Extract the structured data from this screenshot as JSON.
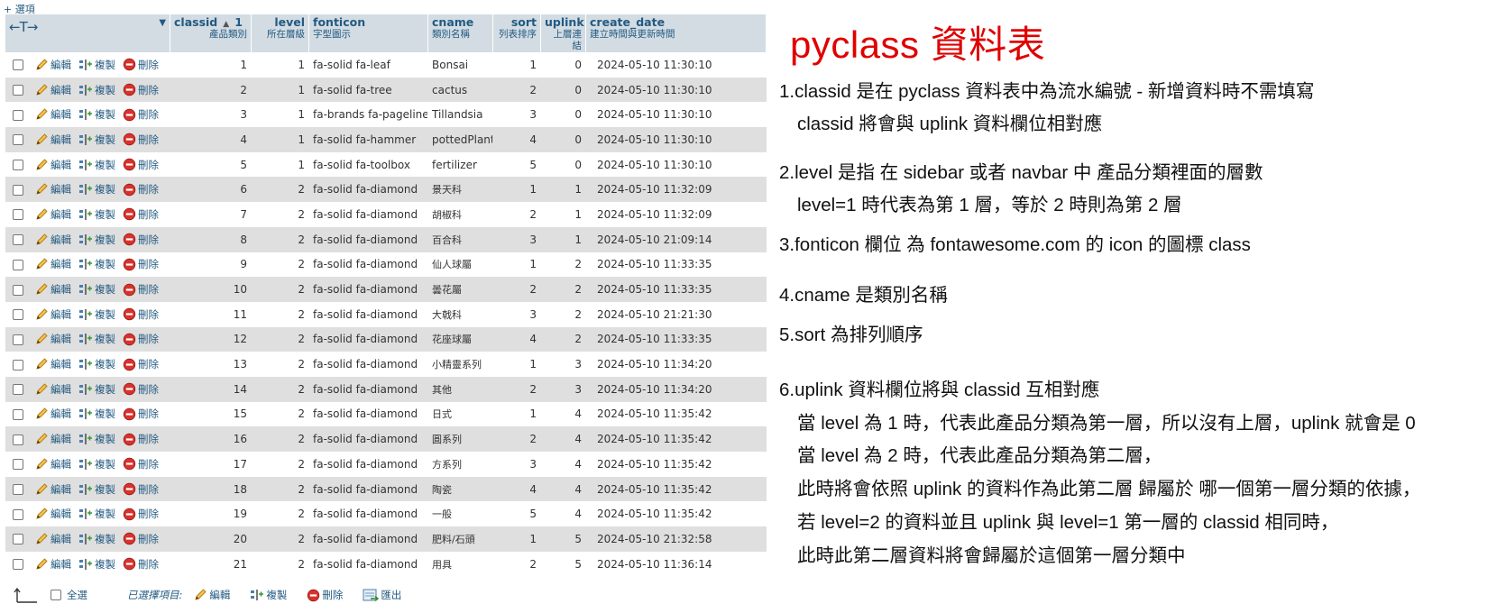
{
  "options_link": "+ 選項",
  "columns": [
    {
      "name": "classid",
      "sub": "產品類別",
      "sort_order": "1"
    },
    {
      "name": "level",
      "sub": "所在層級"
    },
    {
      "name": "fonticon",
      "sub": "字型圖示"
    },
    {
      "name": "cname",
      "sub": "類別名稱"
    },
    {
      "name": "sort",
      "sub": "列表排序"
    },
    {
      "name": "uplink",
      "sub": "上層連結"
    },
    {
      "name": "create_date",
      "sub": "建立時間與更新時間"
    }
  ],
  "row_actions": {
    "edit": "編輯",
    "copy": "複製",
    "delete": "刪除"
  },
  "rows": [
    {
      "classid": "1",
      "level": "1",
      "fonticon": "fa-solid fa-leaf",
      "cname": "Bonsai",
      "sort": "1",
      "uplink": "0",
      "create_date": "2024-05-10 11:30:10"
    },
    {
      "classid": "2",
      "level": "1",
      "fonticon": "fa-solid fa-tree",
      "cname": "cactus",
      "sort": "2",
      "uplink": "0",
      "create_date": "2024-05-10 11:30:10"
    },
    {
      "classid": "3",
      "level": "1",
      "fonticon": "fa-brands fa-pagelines",
      "cname": "Tillandsia",
      "sort": "3",
      "uplink": "0",
      "create_date": "2024-05-10 11:30:10"
    },
    {
      "classid": "4",
      "level": "1",
      "fonticon": "fa-solid fa-hammer",
      "cname": "pottedPlant",
      "sort": "4",
      "uplink": "0",
      "create_date": "2024-05-10 11:30:10"
    },
    {
      "classid": "5",
      "level": "1",
      "fonticon": "fa-solid fa-toolbox",
      "cname": "fertilizer",
      "sort": "5",
      "uplink": "0",
      "create_date": "2024-05-10 11:30:10"
    },
    {
      "classid": "6",
      "level": "2",
      "fonticon": "fa-solid fa-diamond",
      "cname": "景天科",
      "sort": "1",
      "uplink": "1",
      "create_date": "2024-05-10 11:32:09"
    },
    {
      "classid": "7",
      "level": "2",
      "fonticon": "fa-solid fa-diamond",
      "cname": "胡椒科",
      "sort": "2",
      "uplink": "1",
      "create_date": "2024-05-10 11:32:09"
    },
    {
      "classid": "8",
      "level": "2",
      "fonticon": "fa-solid fa-diamond",
      "cname": "百合科",
      "sort": "3",
      "uplink": "1",
      "create_date": "2024-05-10 21:09:14"
    },
    {
      "classid": "9",
      "level": "2",
      "fonticon": "fa-solid fa-diamond",
      "cname": "仙人球屬",
      "sort": "1",
      "uplink": "2",
      "create_date": "2024-05-10 11:33:35"
    },
    {
      "classid": "10",
      "level": "2",
      "fonticon": "fa-solid fa-diamond",
      "cname": "曇花屬",
      "sort": "2",
      "uplink": "2",
      "create_date": "2024-05-10 11:33:35"
    },
    {
      "classid": "11",
      "level": "2",
      "fonticon": "fa-solid fa-diamond",
      "cname": "大戟科",
      "sort": "3",
      "uplink": "2",
      "create_date": "2024-05-10 21:21:30"
    },
    {
      "classid": "12",
      "level": "2",
      "fonticon": "fa-solid fa-diamond",
      "cname": "花座球屬",
      "sort": "4",
      "uplink": "2",
      "create_date": "2024-05-10 11:33:35"
    },
    {
      "classid": "13",
      "level": "2",
      "fonticon": "fa-solid fa-diamond",
      "cname": "小精靈系列",
      "sort": "1",
      "uplink": "3",
      "create_date": "2024-05-10 11:34:20"
    },
    {
      "classid": "14",
      "level": "2",
      "fonticon": "fa-solid fa-diamond",
      "cname": "其他",
      "sort": "2",
      "uplink": "3",
      "create_date": "2024-05-10 11:34:20"
    },
    {
      "classid": "15",
      "level": "2",
      "fonticon": "fa-solid fa-diamond",
      "cname": "日式",
      "sort": "1",
      "uplink": "4",
      "create_date": "2024-05-10 11:35:42"
    },
    {
      "classid": "16",
      "level": "2",
      "fonticon": "fa-solid fa-diamond",
      "cname": "圓系列",
      "sort": "2",
      "uplink": "4",
      "create_date": "2024-05-10 11:35:42"
    },
    {
      "classid": "17",
      "level": "2",
      "fonticon": "fa-solid fa-diamond",
      "cname": "方系列",
      "sort": "3",
      "uplink": "4",
      "create_date": "2024-05-10 11:35:42"
    },
    {
      "classid": "18",
      "level": "2",
      "fonticon": "fa-solid fa-diamond",
      "cname": "陶瓷",
      "sort": "4",
      "uplink": "4",
      "create_date": "2024-05-10 11:35:42"
    },
    {
      "classid": "19",
      "level": "2",
      "fonticon": "fa-solid fa-diamond",
      "cname": "一般",
      "sort": "5",
      "uplink": "4",
      "create_date": "2024-05-10 11:35:42"
    },
    {
      "classid": "20",
      "level": "2",
      "fonticon": "fa-solid fa-diamond",
      "cname": "肥料/石頭",
      "sort": "1",
      "uplink": "5",
      "create_date": "2024-05-10 21:32:58"
    },
    {
      "classid": "21",
      "level": "2",
      "fonticon": "fa-solid fa-diamond",
      "cname": "用具",
      "sort": "2",
      "uplink": "5",
      "create_date": "2024-05-10 11:36:14"
    }
  ],
  "footer": {
    "check_all": "全選",
    "selected_label": "已選擇項目:",
    "edit": "編輯",
    "copy": "複製",
    "delete": "刪除",
    "export": "匯出"
  },
  "notes": {
    "title": "pyclass 資料表",
    "lines": [
      "1.classid 是在 pyclass 資料表中為流水編號 - 新增資料時不需填寫",
      "classid 將會與 uplink 資料欄位相對應",
      "2.level 是指 在 sidebar 或者 navbar 中 產品分類裡面的層數",
      "level=1 時代表為第 1 層，等於 2 時則為第 2 層",
      "3.fonticon 欄位 為 fontawesome.com 的 icon 的圖標 class",
      "4.cname 是類別名稱",
      "5.sort 為排列順序",
      "6.uplink 資料欄位將與 classid 互相對應",
      "當 level 為 1 時，代表此產品分類為第一層，所以沒有上層，uplink 就會是 0",
      "當 level 為 2 時，代表此產品分類為第二層，",
      "此時將會依照 uplink 的資料作為此第二層  歸屬於  哪一個第一層分類的依據，",
      "若 level=2 的資料並且 uplink 與 level=1 第一層的 classid 相同時，",
      "此時此第二層資料將會歸屬於這個第一層分類中"
    ]
  }
}
